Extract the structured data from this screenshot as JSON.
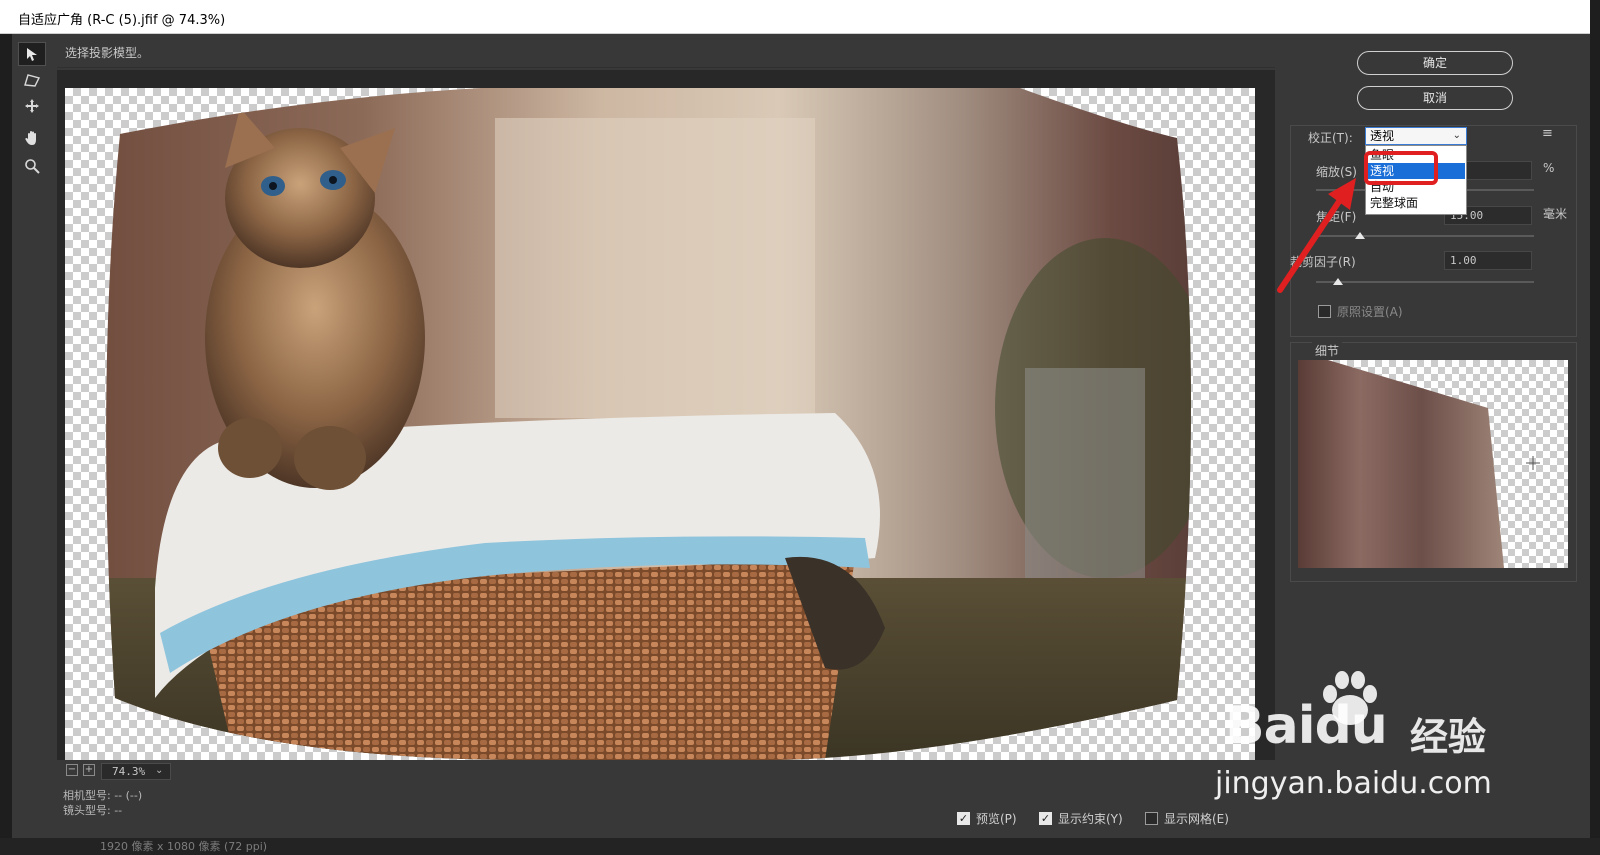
{
  "window": {
    "title": "自适应广角 (R-C (5).jfif @ 74.3%)"
  },
  "hint": "选择投影模型。",
  "tools": [
    {
      "name": "constraint-tool-icon",
      "glyph": "➤"
    },
    {
      "name": "polygon-constraint-tool-icon",
      "glyph": "⬠"
    },
    {
      "name": "move-tool-icon",
      "glyph": "✥"
    },
    {
      "name": "hand-tool-icon",
      "glyph": "✋"
    },
    {
      "name": "zoom-tool-icon",
      "glyph": "⚲"
    }
  ],
  "zoom": {
    "value": "74.3%",
    "minus": "−",
    "plus": "+",
    "dropdown": "⌄"
  },
  "meta": {
    "camera": "相机型号: -- (--)",
    "lens": "镜头型号: --"
  },
  "status_bar": "1920 像素 x 1080 像素 (72 ppi)",
  "checkboxes": [
    {
      "label": "预览(P)",
      "checked": true
    },
    {
      "label": "显示约束(Y)",
      "checked": true
    },
    {
      "label": "显示网格(E)",
      "checked": false
    }
  ],
  "buttons": {
    "ok": "确定",
    "cancel": "取消"
  },
  "settings": {
    "correction_label": "校正(T):",
    "correction_value": "透视",
    "correction_options": [
      "鱼眼",
      "透视",
      "自动",
      "完整球面"
    ],
    "selected_option_index": 1,
    "scale_label": "缩放(S)",
    "scale_unit": "%",
    "focal_label": "焦距(F)",
    "focal_value": "15.00",
    "focal_unit": "毫米",
    "focal_level": 0.2,
    "crop_label": "裁剪因子(R)",
    "crop_value": "1.00",
    "crop_level": 0.1,
    "as_shot_label": "原照设置(A)",
    "menu_icon": "≡"
  },
  "detail": {
    "title": "细节"
  },
  "watermark": {
    "brand": "Bai",
    "brand2": "du",
    "cn": "经验",
    "url": "jingyan.baidu.com"
  },
  "colors": {
    "accent": "#1a6ed8",
    "highlight": "#e02020",
    "panel": "#383838"
  }
}
